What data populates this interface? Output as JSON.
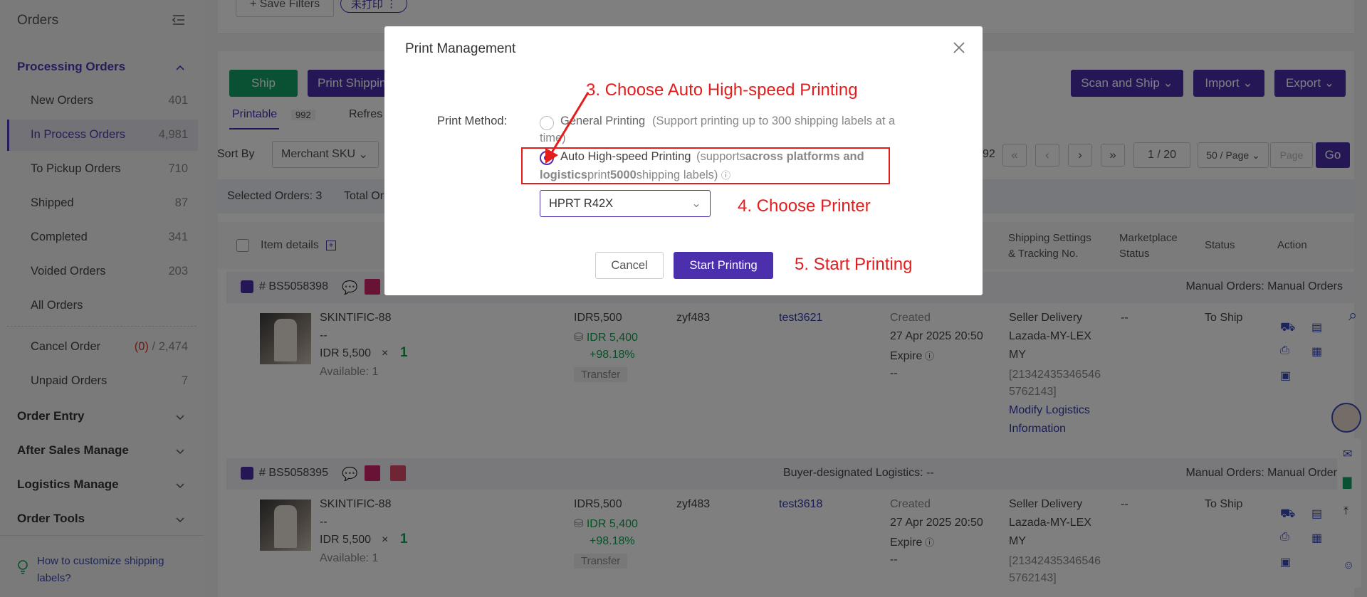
{
  "sidebar": {
    "title": "Orders",
    "groups": {
      "processing": "Processing Orders",
      "order_entry": "Order Entry",
      "after_sales": "After Sales Manage",
      "logistics": "Logistics Manage",
      "order_tools": "Order Tools"
    },
    "items": [
      {
        "label": "New Orders",
        "count": "401"
      },
      {
        "label": "In Process Orders",
        "count": "4,981"
      },
      {
        "label": "To Pickup Orders",
        "count": "710"
      },
      {
        "label": "Shipped",
        "count": "87"
      },
      {
        "label": "Completed",
        "count": "341"
      },
      {
        "label": "Voided Orders",
        "count": "203"
      },
      {
        "label": "All Orders",
        "count": ""
      }
    ],
    "cancel_order": {
      "label": "Cancel Order",
      "red": "(0)",
      "rest": "/ 2,474"
    },
    "unpaid_orders": {
      "label": "Unpaid Orders",
      "count": "7"
    },
    "help_text": "How to customize shipping labels?"
  },
  "toolbar": {
    "save_filters": "+ Save Filters",
    "tag_chip": "未打印",
    "ship": "Ship",
    "print_shipping": "Print Shippin",
    "scan_and_ship": "Scan and Ship",
    "import": "Import",
    "export": "Export"
  },
  "tabs": {
    "printable": "Printable",
    "printable_count": "992",
    "refresh": "Refres"
  },
  "sort": {
    "label": "Sort By",
    "value": "Merchant SKU"
  },
  "pagination": {
    "total_tail": "92",
    "page": "1 / 20",
    "per_page": "50 / Page",
    "page_placeholder": "Page",
    "go": "Go"
  },
  "summary": {
    "selected": "Selected Orders: 3",
    "total": "Total Or"
  },
  "table_headers": {
    "item_details": "Item details",
    "shipping_settings": "Shipping Settings & Tracking No.",
    "marketplace_status": "Marketplace Status",
    "status": "Status",
    "action": "Action"
  },
  "orders": [
    {
      "id": "# BS5058398",
      "source": "Manual Orders: Manual Orders",
      "logistics_note": "",
      "product": "SKINTIFIC-88",
      "variant": "--",
      "price_qty": "IDR 5,500",
      "multiply": "×",
      "qty": "1",
      "available": "Available: 1",
      "amount": "IDR5,500",
      "amount2": "IDR 5,400",
      "margin": "+98.18%",
      "transfer": "Transfer",
      "buyer": "zyf483",
      "store": "test3621",
      "created_label": "Created",
      "created": "27 Apr 2025 20:50",
      "expire": "Expire",
      "expire_val": "--",
      "ship_method": "Seller Delivery",
      "carrier1": "Lazada-MY-LEX",
      "carrier2": "MY",
      "tracking1": "[21342435346546",
      "tracking2": "5762143]",
      "modify1": "Modify Logistics",
      "modify2": "Information",
      "marketplace_status": "--",
      "status": "To Ship"
    },
    {
      "id": "# BS5058395",
      "source": "Manual Orders: Manual Orders",
      "logistics_note": "Buyer-designated Logistics: --",
      "product": "SKINTIFIC-88",
      "variant": "--",
      "price_qty": "IDR 5,500",
      "multiply": "×",
      "qty": "1",
      "available": "Available: 1",
      "amount": "IDR5,500",
      "amount2": "IDR 5,400",
      "margin": "+98.18%",
      "transfer": "Transfer",
      "buyer": "zyf483",
      "store": "test3618",
      "created_label": "Created",
      "created": "27 Apr 2025 20:50",
      "expire": "Expire",
      "expire_val": "--",
      "ship_method": "Seller Delivery",
      "carrier1": "Lazada-MY-LEX",
      "carrier2": "MY",
      "tracking1": "[21342435346546",
      "tracking2": "5762143]",
      "marketplace_status": "--",
      "status": "To Ship"
    }
  ],
  "modal": {
    "title": "Print Management",
    "print_method_label": "Print Method:",
    "general_label": "General Printing",
    "general_hint_line1": "(Support printing up to 300 shipping labels at a",
    "general_hint_line2": "time)",
    "auto_label": "Auto High-speed Printing",
    "auto_hint_a": "(supports",
    "auto_hint_b": "across platforms and",
    "auto_hint_c": "logistics",
    "auto_hint_d": "print",
    "auto_hint_e": "5000",
    "auto_hint_f": "shipping labels)",
    "printer": "HPRT R42X",
    "cancel": "Cancel",
    "start": "Start Printing"
  },
  "annotations": {
    "step3": "3. Choose Auto High-speed Printing",
    "step4": "4. Choose Printer",
    "step5": "5. Start Printing"
  },
  "colors": {
    "brand": "#4b2fad",
    "ship_green": "#14a064",
    "annotation_red": "#e51c1c"
  }
}
